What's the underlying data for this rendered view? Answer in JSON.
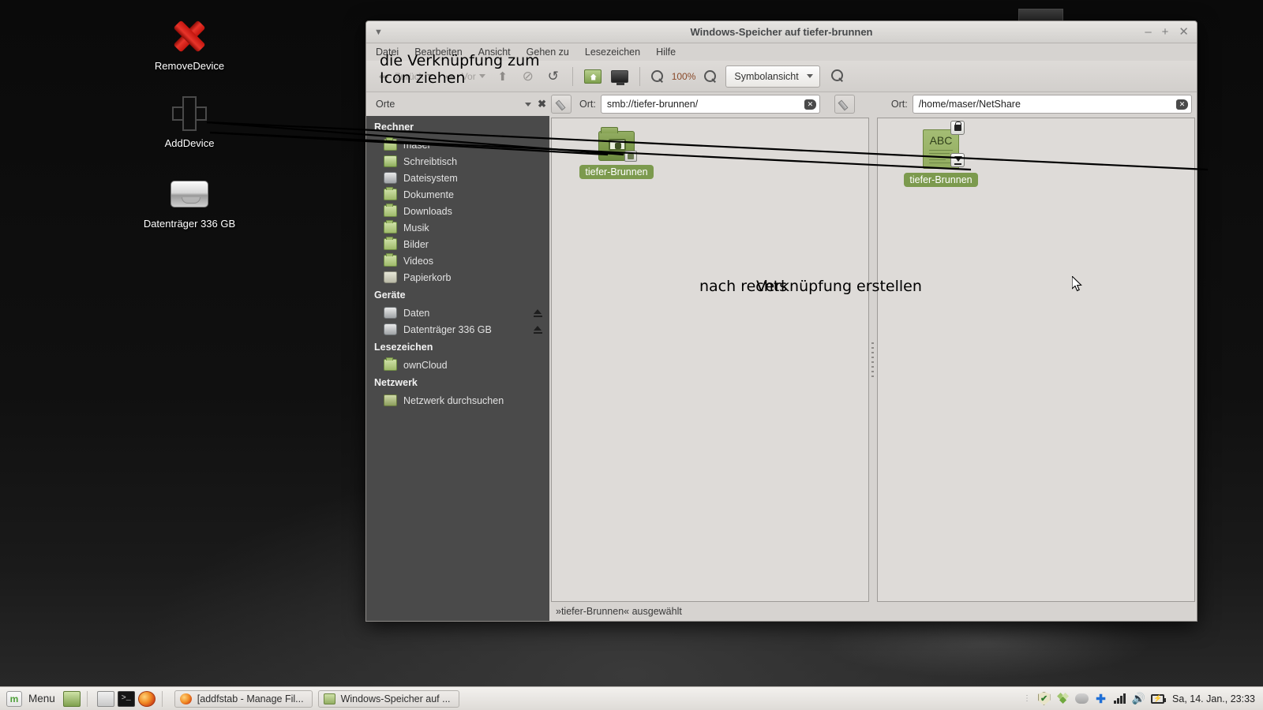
{
  "desktop": {
    "icons": [
      {
        "name": "RemoveDevice",
        "glyph": "x-mark-icon"
      },
      {
        "name": "AddDevice",
        "glyph": "plus-mark-icon"
      },
      {
        "name": "Datenträger 336 GB",
        "glyph": "hard-disk-icon"
      }
    ]
  },
  "window": {
    "title": "Windows-Speicher auf tiefer-brunnen",
    "menu": [
      "Datei",
      "Bearbeiten",
      "Ansicht",
      "Gehen zu",
      "Lesezeichen",
      "Hilfe"
    ],
    "controls": {
      "minimize": "–",
      "maximize": "+",
      "close": "✕"
    },
    "toolbar": {
      "back": "Zurück",
      "forward": "Vor",
      "up_icon": "arrow-up-icon",
      "stop_icon": "stop-icon",
      "reload_icon": "reload-icon",
      "home_icon": "home-icon",
      "computer_icon": "computer-icon",
      "zoom_out_icon": "zoom-out-icon",
      "zoom_level": "100%",
      "zoom_in_icon": "zoom-in-icon",
      "view_mode": "Symbolansicht",
      "search_icon": "search-icon"
    },
    "places_header": {
      "label": "Orte",
      "collapse_icon": "chevron-down-icon",
      "close_icon": "close-icon"
    },
    "location_left": {
      "label": "Ort:",
      "value": "smb://tiefer-brunnen/",
      "edit_icon": "pencil-icon",
      "clear_icon": "clear-icon"
    },
    "location_right": {
      "label": "Ort:",
      "value": "/home/maser/NetShare",
      "edit_icon": "pencil-icon",
      "clear_icon": "clear-icon"
    },
    "statusbar": "»tiefer-Brunnen« ausgewählt"
  },
  "sidebar": {
    "sections": [
      {
        "header": "Rechner",
        "items": [
          {
            "label": "maser",
            "icon": "home-folder-icon"
          },
          {
            "label": "Schreibtisch",
            "icon": "desktop-folder-icon"
          },
          {
            "label": "Dateisystem",
            "icon": "filesystem-disk-icon"
          },
          {
            "label": "Dokumente",
            "icon": "documents-folder-icon"
          },
          {
            "label": "Downloads",
            "icon": "downloads-folder-icon"
          },
          {
            "label": "Musik",
            "icon": "music-folder-icon"
          },
          {
            "label": "Bilder",
            "icon": "pictures-folder-icon"
          },
          {
            "label": "Videos",
            "icon": "videos-folder-icon"
          },
          {
            "label": "Papierkorb",
            "icon": "trash-icon"
          }
        ]
      },
      {
        "header": "Geräte",
        "items": [
          {
            "label": "Daten",
            "icon": "drive-icon",
            "eject": "eject-icon"
          },
          {
            "label": "Datenträger 336 GB",
            "icon": "drive-icon",
            "eject": "eject-icon"
          }
        ]
      },
      {
        "header": "Lesezeichen",
        "items": [
          {
            "label": "ownCloud",
            "icon": "folder-icon"
          }
        ]
      },
      {
        "header": "Netzwerk",
        "items": [
          {
            "label": "Netzwerk durchsuchen",
            "icon": "network-icon"
          }
        ]
      }
    ]
  },
  "panes": {
    "left": {
      "item_label": "tiefer-Brunnen",
      "item_icon": "network-share-folder-icon"
    },
    "right": {
      "item_label": "tiefer-Brunnen",
      "item_icon": "abc-document-icon",
      "item_text": "ABC",
      "lock_badge": "lock-icon",
      "link_badge": "symlink-icon"
    }
  },
  "annotations": [
    {
      "id": "anno-drag",
      "text": "die Verknüpfung zum\nIcon ziehen"
    },
    {
      "id": "anno-right",
      "text": "nach rechts"
    },
    {
      "id": "anno-create",
      "text": "Verknüpfung erstellen"
    }
  ],
  "taskbar": {
    "menu_label": "Menu",
    "quicklaunch": [
      "show-desktop-icon",
      "files-icon",
      "terminal-icon",
      "firefox-icon"
    ],
    "windows": [
      {
        "label": "[addfstab - Manage Fil...",
        "icon": "firefox-icon"
      },
      {
        "label": "Windows-Speicher auf ...",
        "icon": "file-manager-icon"
      }
    ],
    "tray": [
      "update-shield-icon",
      "dropbox-icon",
      "cloud-icon",
      "bluetooth-icon",
      "network-signal-icon",
      "volume-icon",
      "battery-icon"
    ],
    "clock": "Sa, 14. Jan., 23:33"
  },
  "colors": {
    "accent_green": "#7c9a4e",
    "sidebar_bg": "#4a4a4a",
    "window_bg": "#d6d3d0",
    "desktop_bg": "#0b0b0b"
  }
}
